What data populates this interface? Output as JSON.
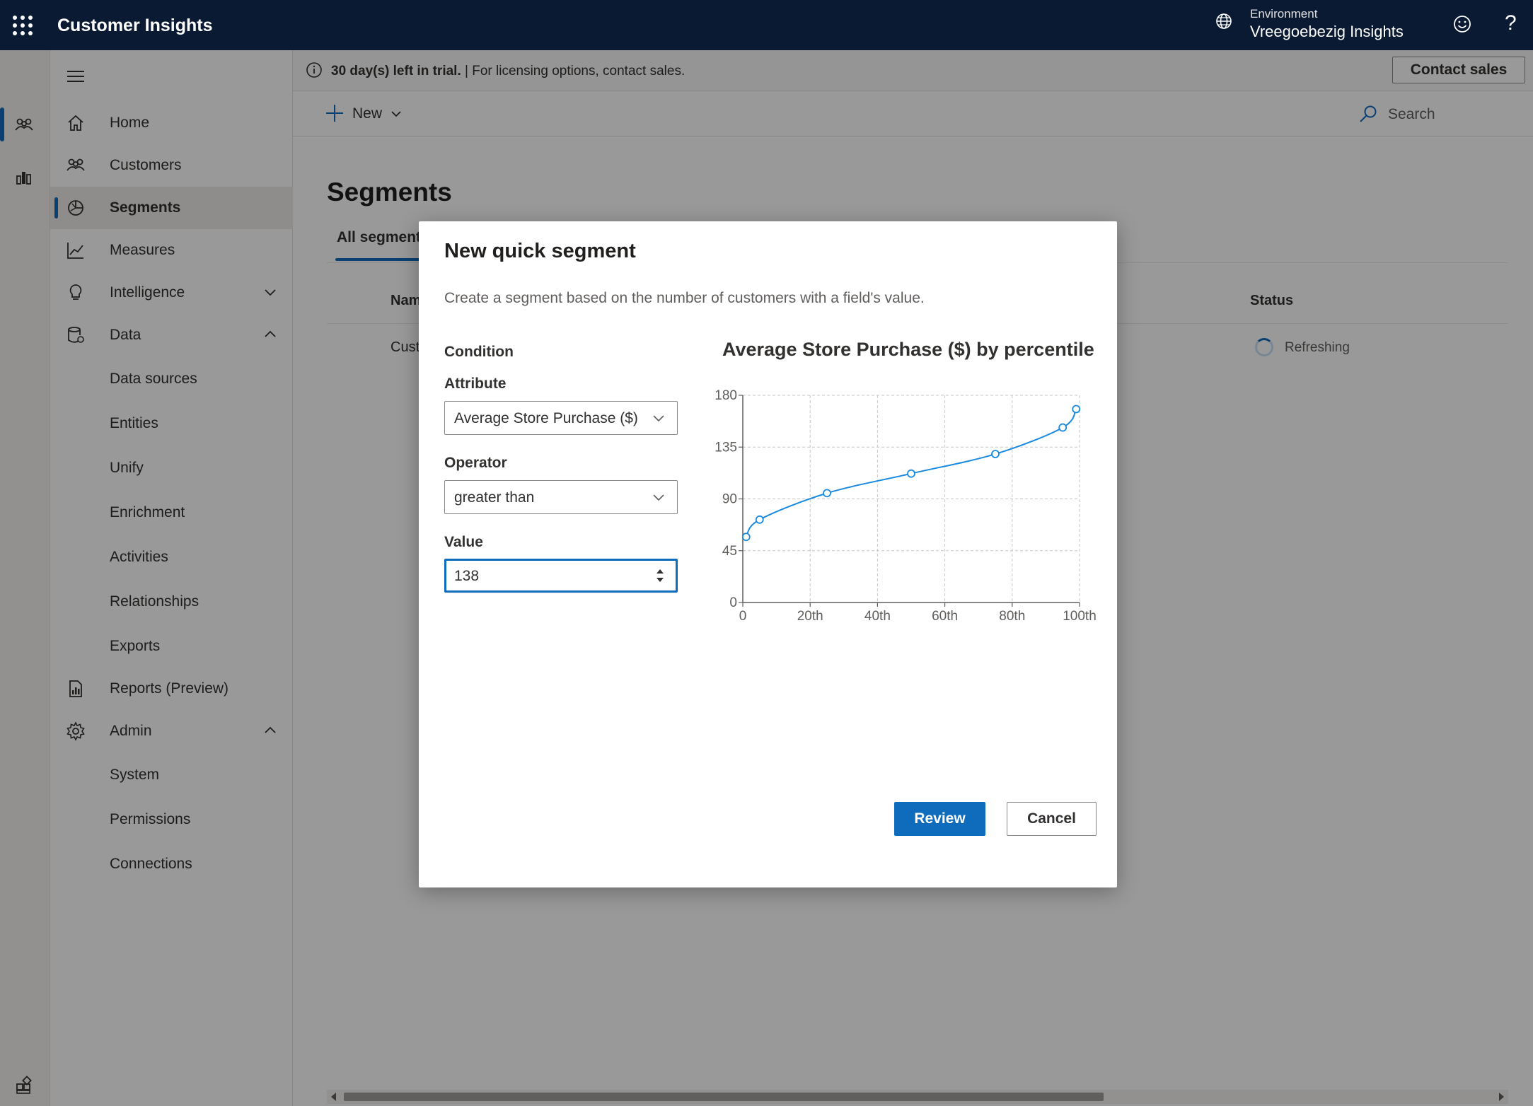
{
  "topbar": {
    "app_title": "Customer Insights",
    "environment_label": "Environment",
    "environment_name": "Vreegoebezig Insights",
    "help_glyph": "?"
  },
  "sidenav": {
    "items": [
      {
        "label": "Home",
        "icon": "home-icon"
      },
      {
        "label": "Customers",
        "icon": "customers-icon"
      },
      {
        "label": "Segments",
        "icon": "segments-icon",
        "active": true
      },
      {
        "label": "Measures",
        "icon": "measures-icon"
      },
      {
        "label": "Intelligence",
        "icon": "lightbulb-icon",
        "expandable": "collapsed"
      },
      {
        "label": "Data",
        "icon": "data-icon",
        "expandable": "expanded"
      }
    ],
    "data_subitems": [
      "Data sources",
      "Entities",
      "Unify",
      "Enrichment",
      "Activities",
      "Relationships",
      "Exports"
    ],
    "reports": {
      "label": "Reports (Preview)",
      "icon": "report-icon"
    },
    "admin": {
      "label": "Admin",
      "icon": "gear-icon",
      "expandable": "expanded"
    },
    "admin_subitems": [
      "System",
      "Permissions",
      "Connections"
    ]
  },
  "trial": {
    "bold_text": "30 day(s) left in trial.",
    "separator": "|",
    "text": "For licensing options, contact sales.",
    "contact_button": "Contact sales"
  },
  "commandbar": {
    "new_label": "New",
    "search_label": "Search"
  },
  "page": {
    "title": "Segments",
    "tab_all": "All segments",
    "col_name": "Name",
    "col_status": "Status",
    "row_name": "Customers",
    "row_status": "Refreshing"
  },
  "dialog": {
    "title": "New quick segment",
    "description": "Create a segment based on the number of customers with a field's value.",
    "condition_label": "Condition",
    "attribute_label": "Attribute",
    "attribute_value": "Average Store Purchase ($)",
    "operator_label": "Operator",
    "operator_value": "greater than",
    "value_label": "Value",
    "value_value": "138",
    "review_button": "Review",
    "cancel_button": "Cancel"
  },
  "chart_data": {
    "type": "line",
    "title": "Average Store Purchase ($) by percentile",
    "xlabel": "",
    "ylabel": "",
    "x_tick_labels": [
      "0",
      "20th",
      "40th",
      "60th",
      "80th",
      "100th"
    ],
    "y_tick_labels": [
      "0",
      "45",
      "90",
      "135",
      "180"
    ],
    "xlim": [
      0,
      100
    ],
    "ylim": [
      0,
      180
    ],
    "grid": true,
    "series": [
      {
        "x": [
          1,
          5,
          25,
          50,
          75,
          95,
          99
        ],
        "y": [
          57,
          72,
          95,
          112,
          129,
          152,
          168
        ]
      }
    ],
    "colors": {
      "line": "#1a8ae0",
      "grid": "#c8c6c4",
      "axis": "#605e5c"
    }
  }
}
